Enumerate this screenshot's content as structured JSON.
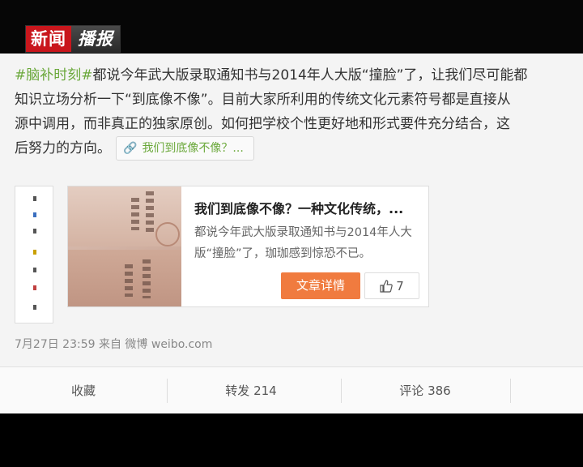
{
  "logo": {
    "part1": "新闻",
    "part2": "播报"
  },
  "post": {
    "hashtag": "#脑补时刻#",
    "line1": "都说今年武大版录取通知书与2014年人大版“撞脸”了，让我们尽可能都",
    "line2": "知识立场分析一下“到底像不像”。目前大家所利用的传统文化元素符号都是直接从",
    "line3": "源中调用，而非真正的独家原创。如何把学校个性更好地和形式要件充分结合，这",
    "line4": "后努力的方向。",
    "link_icon": "link-icon",
    "link_text": "我们到底像不像？..."
  },
  "card": {
    "title": "我们到底像不像？一种文化传统，...",
    "desc": "都说今年武大版录取通知书与2014年人大版“撞脸”了，珈珈感到惊恐不已。",
    "detail_button": "文章详情",
    "like_icon": "thumbs-up-icon",
    "like_count": "7"
  },
  "meta": "7月27日 23:59 来自 微博 weibo.com",
  "actions": {
    "favorite": "收藏",
    "repost": "转发 214",
    "comment": "评论 386"
  },
  "colors": {
    "hashtag": "#6aa83a",
    "detail_button_bg": "#f07b3f",
    "logo_red": "#c9161c"
  }
}
